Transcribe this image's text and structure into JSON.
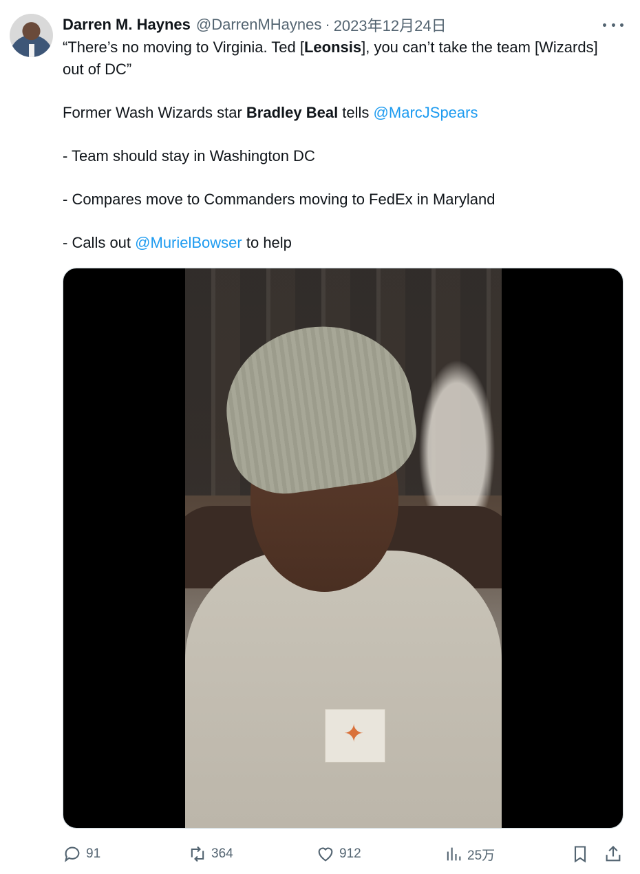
{
  "author": {
    "name": "Darren M. Haynes",
    "handle": "@DarrenMHaynes",
    "separator": "·",
    "date": "2023年12月24日"
  },
  "tweet": {
    "line1a": "“There’s no moving to Virginia. Ted [",
    "line1b": "Leonsis",
    "line1c": "], you can’t take the team [Wizards] out of DC”",
    "line2a": "Former Wash Wizards star ",
    "line2b": "Bradley Beal",
    "line2c": " tells ",
    "mention1": "@MarcJSpears",
    "bullet1": "- Team should stay in Washington DC",
    "bullet2": "- Compares move to Commanders moving to FedEx in Maryland",
    "bullet3a": "- Calls out ",
    "mention2": "@MurielBowser",
    "bullet3b": " to help"
  },
  "actions": {
    "replies": "91",
    "retweets": "364",
    "likes": "912",
    "views": "25万"
  },
  "icons": [
    "more-icon",
    "reply-icon",
    "retweet-icon",
    "like-icon",
    "views-icon",
    "bookmark-icon",
    "share-icon"
  ],
  "colors": {
    "accent": "#1d9bf0",
    "muted": "#536471",
    "text": "#0f1419"
  }
}
